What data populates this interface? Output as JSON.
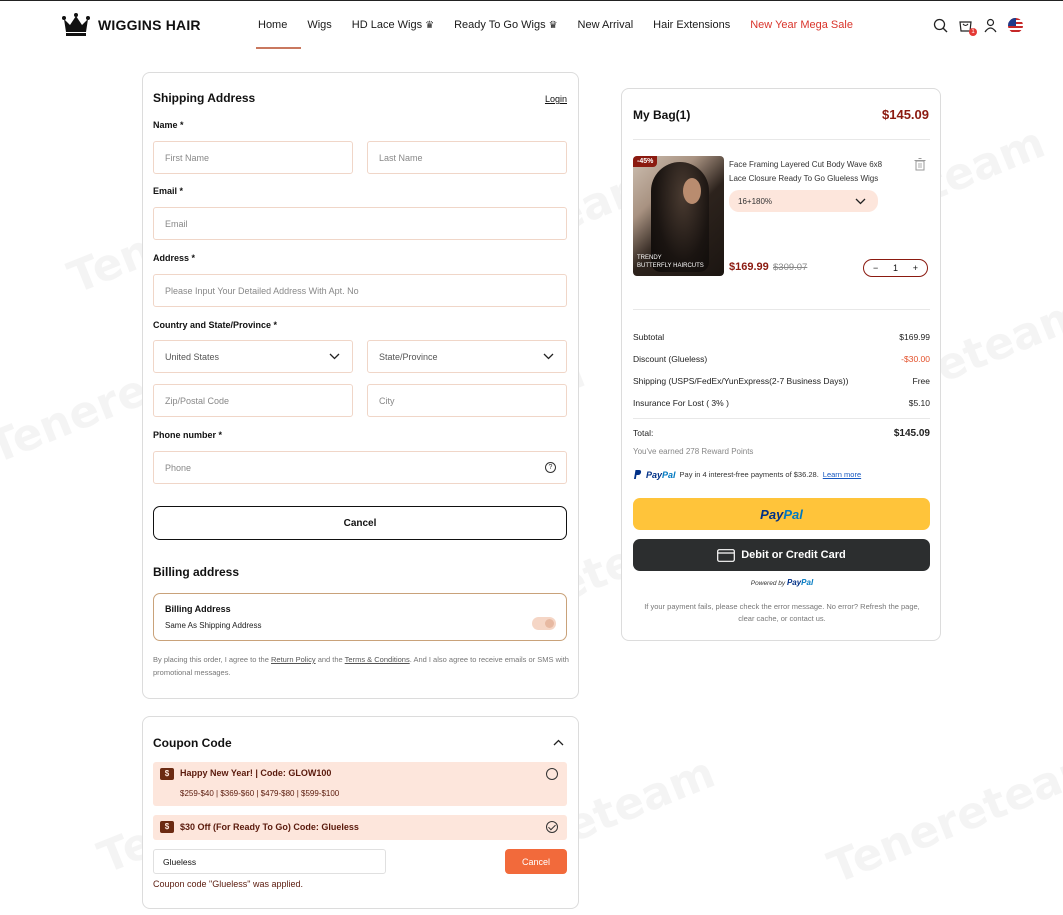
{
  "header": {
    "brand": "WIGGINS HAIR",
    "nav": [
      {
        "label": "Home",
        "crown": ""
      },
      {
        "label": "Wigs",
        "crown": ""
      },
      {
        "label": "HD Lace Wigs",
        "crown": "♛"
      },
      {
        "label": "Ready To Go Wigs",
        "crown": "♛"
      },
      {
        "label": "New Arrival",
        "crown": ""
      },
      {
        "label": "Hair Extensions",
        "crown": ""
      },
      {
        "label": "New Year Mega Sale",
        "crown": ""
      }
    ],
    "cart_count": "1"
  },
  "watermark": "Tenereteam",
  "shipping": {
    "title": "Shipping Address",
    "login": "Login",
    "name_label": "Name *",
    "first_name_placeholder": "First Name",
    "last_name_placeholder": "Last Name",
    "email_label": "Email *",
    "email_placeholder": "Email",
    "address_label": "Address *",
    "address_placeholder": "Please Input Your Detailed Address With Apt. No",
    "country_label": "Country and State/Province *",
    "country_value": "United States",
    "state_placeholder": "State/Province",
    "zip_placeholder": "Zip/Postal Code",
    "city_placeholder": "City",
    "phone_label": "Phone number *",
    "phone_placeholder": "Phone",
    "phone_help": "?",
    "cancel_label": "Cancel"
  },
  "billing": {
    "title": "Billing address",
    "box_title": "Billing Address",
    "box_sub": "Same As Shipping Address",
    "terms_pre": "By placing this order, I agree to the ",
    "terms_link1": "Return Policy",
    "terms_mid": " and the ",
    "terms_link2": "Terms & Conditions",
    "terms_post": ". And I also agree to receive emails or SMS with promotional messages."
  },
  "coupon": {
    "title": "Coupon Code",
    "items": [
      {
        "icon": "$",
        "title": "Happy New Year! | Code: GLOW100",
        "tiers": "$259-$40 | $369-$60 | $479-$80 | $599-$100"
      },
      {
        "icon": "$",
        "title": "$30 Off (For Ready To Go) Code: Glueless",
        "tiers": ""
      }
    ],
    "input_value": "Glueless",
    "cancel_label": "Cancel",
    "applied_msg": "Coupon code \"Glueless\" was applied."
  },
  "bag": {
    "title": "My Bag(1)",
    "total": "$145.09",
    "item": {
      "discount_badge": "-45%",
      "thumb_caption_1": "TRENDY",
      "thumb_caption_2": "BUTTERFLY HAIRCUTS",
      "name": "Face Framing Layered Cut Body Wave 6x8 Lace Closure Ready To Go Glueless Wigs",
      "variant": "16+180%",
      "price": "$169.99",
      "old_price": "$309.07",
      "qty": "1",
      "minus": "−",
      "plus": "+"
    },
    "summary": [
      {
        "label": "Subtotal",
        "value": "$169.99"
      },
      {
        "label": "Discount (Glueless)",
        "value": "-$30.00"
      },
      {
        "label": "Shipping (USPS/FedEx/YunExpress(2-7 Business Days))",
        "value": "Free"
      },
      {
        "label": "Insurance For Lost ( 3% )",
        "value": "$5.10"
      }
    ],
    "total_label": "Total:",
    "total_value": "$145.09",
    "reward": "You've earned 278 Reward Points",
    "paypal_pay": "Pay",
    "paypal_pal": "Pal",
    "paylater_text": "Pay in 4 interest-free payments of $36.28.",
    "learn_more": "Learn more",
    "card_button": "Debit or Credit Card",
    "powered_by": "Powered by",
    "fail_note": "If your payment fails, please check the error message. No error? Refresh the page, clear cache, or contact us."
  },
  "colors": {
    "accent": "#8b1a10",
    "coupon_bg": "#fde6dc",
    "paypal_yellow": "#ffc43a",
    "sale_red": "#d9342b",
    "cancel_orange": "#f26a3b"
  }
}
